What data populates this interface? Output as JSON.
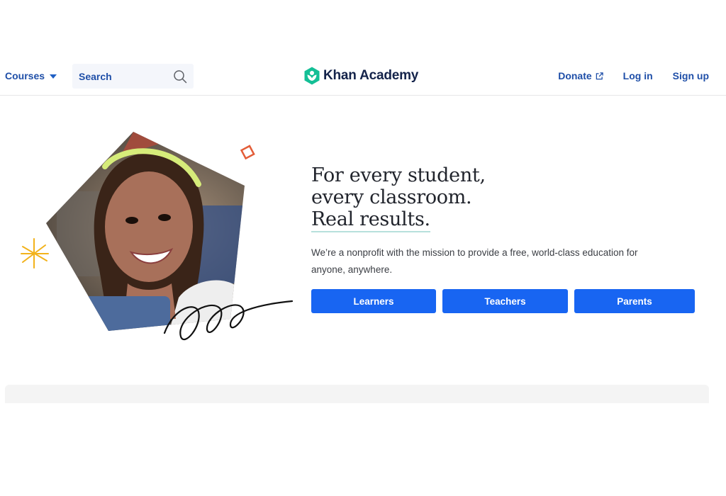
{
  "header": {
    "courses_label": "Courses",
    "search_placeholder": "Search",
    "logo_text": "Khan Academy",
    "donate_label": "Donate",
    "login_label": "Log in",
    "signup_label": "Sign up"
  },
  "hero": {
    "headline_lines": [
      "For every student,",
      "every classroom.",
      "Real results."
    ],
    "subtext": "We’re a nonprofit with the mission to provide a free, world-class education for anyone, anywhere.",
    "buttons": [
      "Learners",
      "Teachers",
      "Parents"
    ]
  },
  "colors": {
    "link": "#1f4fa8",
    "primary_button": "#1865f2",
    "logo_green": "#14bf96",
    "logo_text": "#14234a",
    "headline_underline": "#b7e0dc",
    "accent_orange": "#e35d38",
    "accent_yellow": "#f2b21b"
  }
}
